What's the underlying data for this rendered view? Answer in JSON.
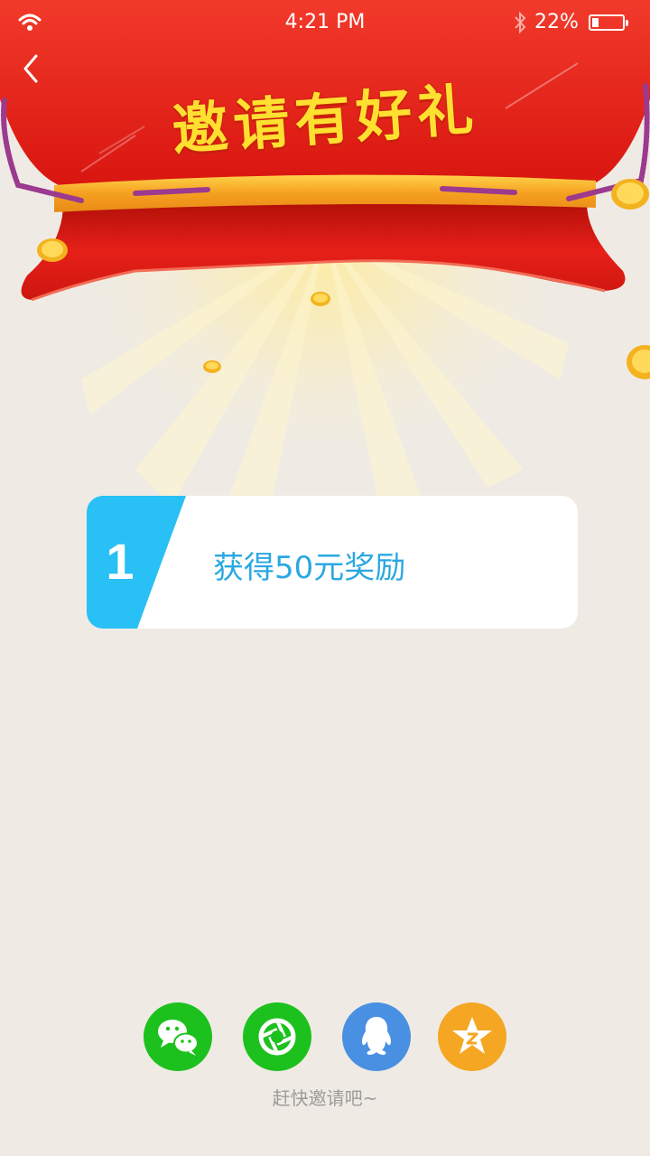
{
  "status_bar": {
    "time": "4:21 PM",
    "battery_percent": "22%",
    "battery_level": 0.22,
    "icons": [
      "wifi-icon",
      "bluetooth-icon",
      "battery-icon"
    ]
  },
  "header": {
    "back_icon": "chevron-left-icon",
    "title": "邀请有好礼"
  },
  "reward_card": {
    "number": "1",
    "text": "获得50元奖励",
    "accent_color": "#29c0f5",
    "text_color": "#2aa8e0"
  },
  "share": {
    "buttons": [
      {
        "icon": "wechat-icon",
        "color": "#1dc11d"
      },
      {
        "icon": "moments-icon",
        "color": "#1dc11d"
      },
      {
        "icon": "qq-icon",
        "color": "#4a90e2"
      },
      {
        "icon": "qzone-icon",
        "color": "#f5a623"
      }
    ],
    "hint": "赶快邀请吧~"
  },
  "colors": {
    "background": "#efebe4",
    "banner_red": "#e8221a",
    "title_yellow": "#ffe030",
    "ribbon_orange": "#f7a32a"
  }
}
